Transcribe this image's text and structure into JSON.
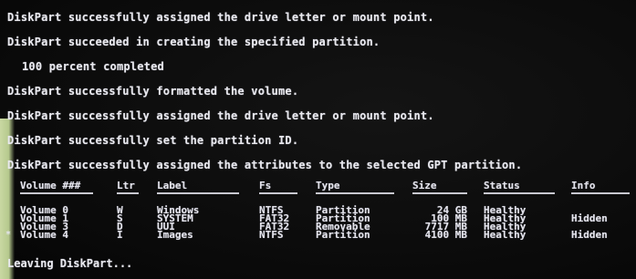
{
  "console": {
    "lines": [
      "DiskPart successfully assigned the drive letter or mount point.",
      "DiskPart succeeded in creating the specified partition.",
      "100 percent completed",
      "DiskPart successfully formatted the volume.",
      "DiskPart successfully assigned the drive letter or mount point.",
      "DiskPart successfully set the partition ID.",
      "DiskPart successfully assigned the attributes to the selected GPT partition."
    ],
    "footer": "Leaving DiskPart..."
  },
  "volume_table": {
    "headers": {
      "volume": "Volume ###",
      "ltr": "Ltr",
      "label": "Label",
      "fs": "Fs",
      "type": "Type",
      "size": "Size",
      "status": "Status",
      "info": "Info"
    },
    "rows": [
      {
        "volume": "Volume 0",
        "ltr": "W",
        "label": "Windows",
        "fs": "NTFS",
        "type": "Partition",
        "size": "24 GB",
        "status": "Healthy",
        "info": ""
      },
      {
        "volume": "Volume 1",
        "ltr": "S",
        "label": "SYSTEM",
        "fs": "FAT32",
        "type": "Partition",
        "size": "100 MB",
        "status": "Healthy",
        "info": "Hidden"
      },
      {
        "volume": "Volume 3",
        "ltr": "D",
        "label": "UUI",
        "fs": "FAT32",
        "type": "Removable",
        "size": "7717 MB",
        "status": "Healthy",
        "info": ""
      },
      {
        "volume": "Volume 4",
        "ltr": "I",
        "label": "Images",
        "fs": "NTFS",
        "type": "Partition",
        "size": "4100 MB",
        "status": "Healthy",
        "info": "Hidden"
      }
    ],
    "selected_marker": "*"
  },
  "colors": {
    "background": "#0a0a0a",
    "text": "#e9e9ee",
    "bezel": "#c9d8a2"
  }
}
